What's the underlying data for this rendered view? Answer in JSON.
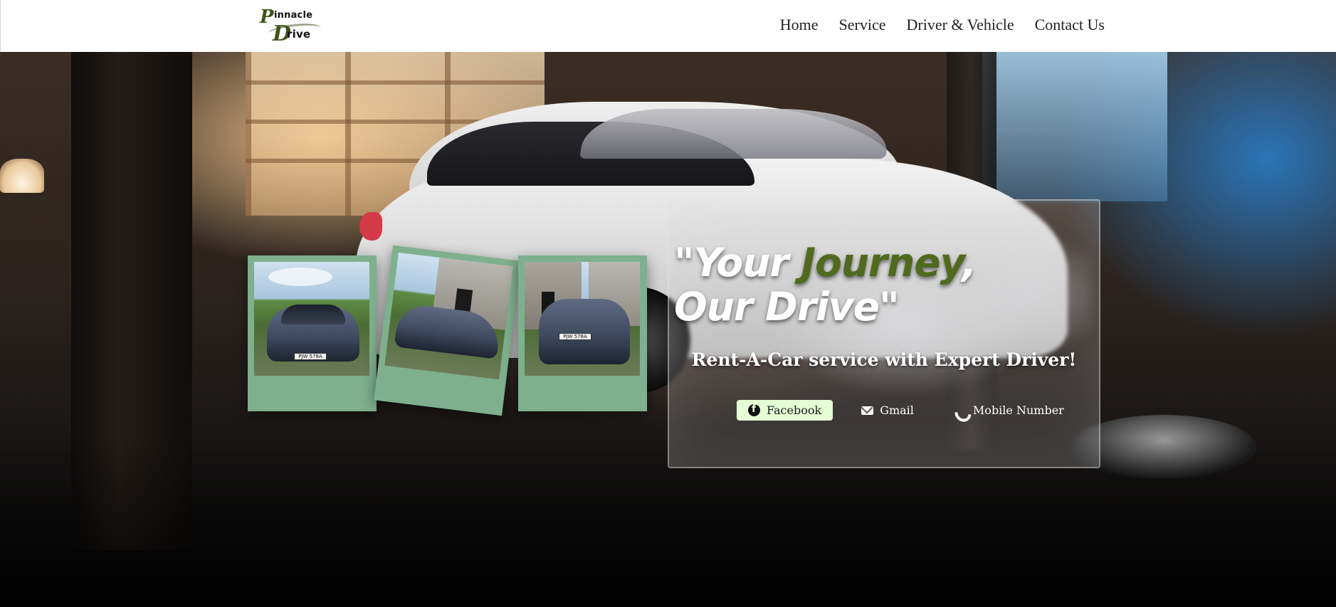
{
  "header": {
    "logo": {
      "text_top": "Pinnacle",
      "text_bottom": "Drive"
    },
    "nav": [
      {
        "label": "Home"
      },
      {
        "label": "Service"
      },
      {
        "label": "Driver & Vehicle"
      },
      {
        "label": "Contact Us"
      }
    ]
  },
  "hero": {
    "headline_line1_start": "\"Your ",
    "headline_accent": "Journey",
    "headline_line1_end": ",",
    "headline_line2": "Our Drive\"",
    "tagline": "Rent-A-Car service with Expert Driver!",
    "contacts": [
      {
        "label": "Facebook",
        "icon": "facebook-icon"
      },
      {
        "label": "Gmail",
        "icon": "mail-icon"
      },
      {
        "label": "Mobile Number",
        "icon": "phone-icon"
      }
    ],
    "photos": [
      {
        "subject": "car-front-view",
        "plate": "PJW 578A"
      },
      {
        "subject": "car-side-view"
      },
      {
        "subject": "car-rear-view",
        "plate": "PJW 578A"
      }
    ]
  },
  "colors": {
    "accent_green": "#4f6a1e",
    "polaroid_frame": "#7eb08d",
    "facebook_button_bg": "#e4ffd6"
  }
}
